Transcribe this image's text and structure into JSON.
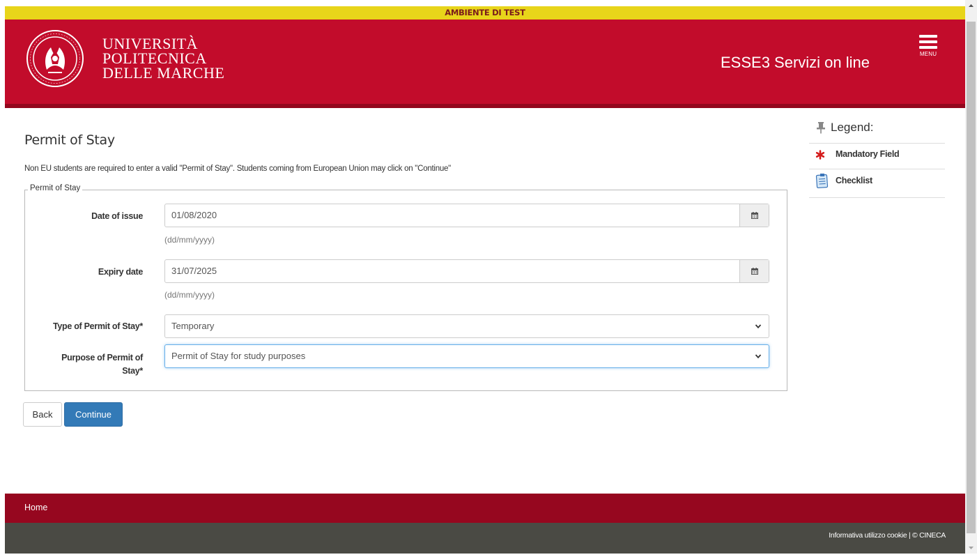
{
  "banner": {
    "text": "AMBIENTE DI TEST"
  },
  "header": {
    "university_lines": [
      "UNIVERSITÀ",
      "POLITECNICA",
      "DELLE MARCHE"
    ],
    "app_title": "ESSE3 Servizi on line",
    "menu_label": "MENU",
    "logo_icon": "university-seal-logo",
    "brand_color": "#c20c2b"
  },
  "page": {
    "title": "Permit of Stay",
    "intro": "Non EU students are required to enter a valid \"Permit of Stay\". Students coming from European Union may click on \"Continue\""
  },
  "form": {
    "legend": "Permit of Stay",
    "date_of_issue": {
      "label": "Date of issue",
      "value": "01/08/2020",
      "hint": "(dd/mm/yyyy)",
      "icon": "calendar-icon"
    },
    "expiry_date": {
      "label": "Expiry date",
      "value": "31/07/2025",
      "hint": "(dd/mm/yyyy)",
      "icon": "calendar-icon"
    },
    "permit_type": {
      "label": "Type of Permit of Stay*",
      "value": "Temporary"
    },
    "permit_purpose": {
      "label_line1": "Purpose of Permit of",
      "label_line2": "Stay*",
      "value": "Permit of Stay for study purposes"
    }
  },
  "buttons": {
    "back": "Back",
    "continue": "Continue",
    "continue_color": "#337ab7"
  },
  "sidebar": {
    "legend_title": "Legend:",
    "legend_icon": "pin-icon",
    "items": [
      {
        "icon": "asterisk-icon",
        "label": "Mandatory Field"
      },
      {
        "icon": "checklist-icon",
        "label": "Checklist"
      }
    ]
  },
  "footer": {
    "home": "Home",
    "credits": "Informativa utilizzo cookie | © CINECA"
  }
}
